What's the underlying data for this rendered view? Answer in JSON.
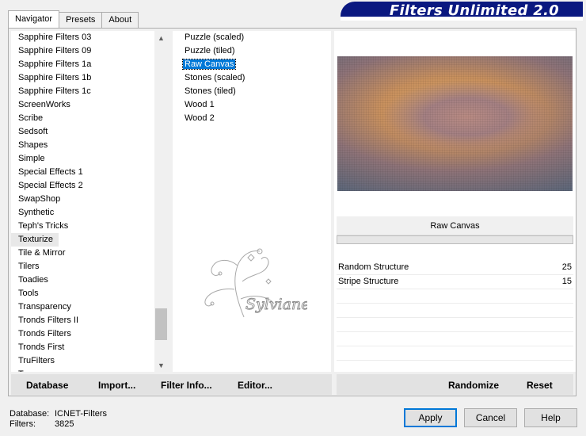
{
  "tabs": [
    "Navigator",
    "Presets",
    "About"
  ],
  "banner_title": "Filters Unlimited 2.0",
  "categories": [
    "Sapphire Filters 03",
    "Sapphire Filters 09",
    "Sapphire Filters 1a",
    "Sapphire Filters 1b",
    "Sapphire Filters 1c",
    "ScreenWorks",
    "Scribe",
    "Sedsoft",
    "Shapes",
    "Simple",
    "Special Effects 1",
    "Special Effects 2",
    "SwapShop",
    "Synthetic",
    "Teph's Tricks",
    "Texturize",
    "Tile & Mirror",
    "Tilers",
    "Toadies",
    "Tools",
    "Transparency",
    "Tronds Filters II",
    "Tronds Filters",
    "Tronds First",
    "TruFilters",
    "Tramages"
  ],
  "selected_category": "Texturize",
  "filters": [
    "Puzzle (scaled)",
    "Puzzle (tiled)",
    "Raw Canvas",
    "Stones (scaled)",
    "Stones (tiled)",
    "Wood 1",
    "Wood 2"
  ],
  "selected_filter": "Raw Canvas",
  "filter_name": "Raw Canvas",
  "params": [
    {
      "label": "Random Structure",
      "value": "25"
    },
    {
      "label": "Stripe Structure",
      "value": "15"
    }
  ],
  "left_buttons": {
    "database": "Database",
    "import": "Import...",
    "filter_info": "Filter Info...",
    "editor": "Editor..."
  },
  "right_buttons": {
    "randomize": "Randomize",
    "reset": "Reset"
  },
  "info": {
    "database_label": "Database:",
    "database_value": "ICNET-Filters",
    "filters_label": "Filters:",
    "filters_value": "3825"
  },
  "dialog_buttons": {
    "apply": "Apply",
    "cancel": "Cancel",
    "help": "Help"
  },
  "watermark_text": "Sylviane"
}
